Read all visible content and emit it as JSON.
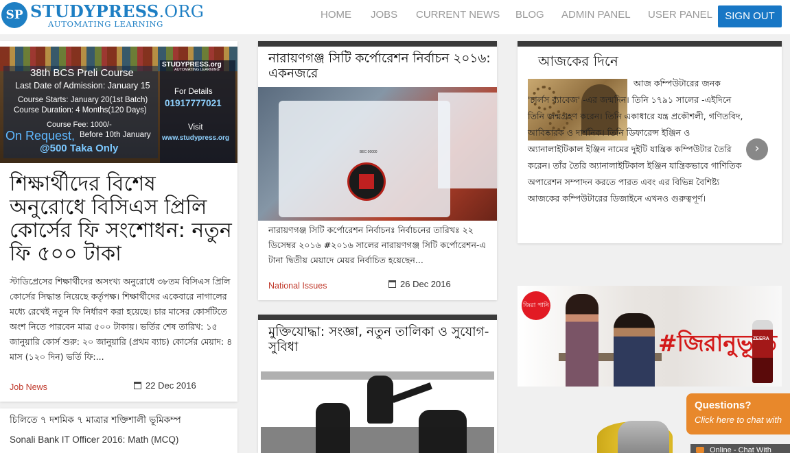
{
  "header": {
    "logo_mark": "SP",
    "logo_name": "STUDYPRESS",
    "logo_tld": ".ORG",
    "tagline": "AUTOMATING LEARNING",
    "nav": [
      "HOME",
      "JOBS",
      "CURRENT NEWS",
      "BLOG",
      "ADMIN PANEL",
      "USER PANEL"
    ],
    "signout_label": "SIGN OUT",
    "accent_color": "#1877c5"
  },
  "banner": {
    "course_title": "38th BCS Preli Course",
    "admission": "Last Date of Admission: January 15",
    "starts": "Course Starts: January 20(1st Batch)",
    "duration": "Course Duration: 4 Months(120 Days)",
    "fee_label": "Course Fee: 1000/-",
    "on_request": "On Request,",
    "before": "Before 10th January",
    "offer": "@500 Taka Only",
    "brand": "STUDYPRESS.org",
    "brand_tag": "AUTOMATING LEARNING",
    "details_label": "For Details",
    "phone": "01917777021",
    "visit_label": "Visit",
    "website": "www.studypress.org"
  },
  "left_article": {
    "title": "শিক্ষার্থীদের বিশেষ অনুরোধে বিসিএস প্রিলি কোর্সের ফি সংশোধন: নতুন ফি ৫০০ টাকা",
    "excerpt": "স্টাডিপ্রেসের শিক্ষার্থীদের অসংখ্য অনুরোধে ৩৮তম বিসিএস প্রিলি কোর্সের সিদ্ধান্ত নিয়েছে কর্তৃপক্ষ। শিক্ষার্থীদের একেবারে নাগালের মধ্যে রেখেই নতুন ফি নির্ধারণ করা হয়েছে। চার মাসের কোর্সটিতে অংশ নিতে পারবেন মাত্র ৫০০ টাকায়। ভর্তির শেষ তারিখ: ১৫ জানুয়ারি কোর্স শুরু: ২০ জানুয়ারি (প্রথম ব্যাচ) কোর্সের মেয়াদ: ৪ মাস (১২০ দিন) ভর্তি ফি:...",
    "category": "Job News",
    "date": "22 Dec 2016"
  },
  "left_list": [
    "চিলিতে ৭ দশমিক ৭ মাত্রার শক্তিশালী ভূমিকম্প",
    "Sonali Bank IT Officer 2016: Math (MCQ)"
  ],
  "middle_article": {
    "title": "নারায়ণগঞ্জ সিটি কর্পোরেশন নির্বাচন ২০১৬: একনজরে",
    "excerpt": "নারায়ণগঞ্জ সিটি কর্পোরেশন নির্বাচনঃ নির্বাচনের তারিখঃ ২২ ডিসেম্বর ২০১৬ #২০১৬ সালের নারায়ণগঞ্জ সিটি কর্পোরেশন-এ টানা দ্বিতীয় মেয়াদে মেয়র নির্বাচিত হয়েছেন...",
    "category": "National Issues",
    "date": "26 Dec 2016",
    "box_label": "BEC 00000"
  },
  "middle_article2": {
    "title": "মুক্তিযোদ্ধা: সংজ্ঞা, নতুন তালিকা ও সুযোগ-সুবিধা"
  },
  "history": {
    "title": "আজকের দিনে",
    "text": "আজ কম্পিউটারের জনক 'চার্লস ব্যাবেজ' -এর জন্মদিন। তিনি ১৭৯১ সালের -এইদিনে তিনি জন্মগ্রহণ করেন। তিনি একাধারে যন্ত্র প্রকৌশলী, গণিতবিদ, আবিষ্কারক ও দার্শনিক। তিনি ডিফারেন্স ইঞ্জিন ও অ্যানালাইটিকাল ইঞ্জিন নামের দুইটি যান্ত্রিক কম্পিউটার তৈরি করেন। তাঁর তৈরি অ্যানালাইটিকাল ইঞ্জিন যান্ত্রিকভাবে গাণিতিক অপারেশন সম্পাদন করতে পারত এবং এর বিভিন্ন বৈশিষ্ট্য আজকের কম্পিউটারের ডিজাইনে এখনও গুরুত্বপূর্ণ।",
    "next_icon": "chevron-right-icon"
  },
  "ad": {
    "brand": "জিরা পানি",
    "headline": "#জিরানুভূতি",
    "bottle_label": "ZEERA"
  },
  "chat": {
    "title": "Questions?",
    "subtitle": "Click here to chat with",
    "online": "Online - Chat With"
  }
}
